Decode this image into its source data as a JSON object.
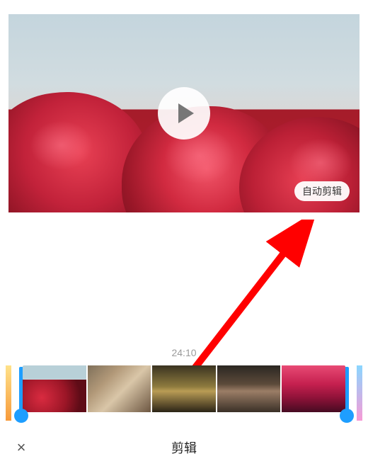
{
  "preview": {
    "play_icon": "play-icon",
    "auto_edit_label": "自动剪辑"
  },
  "timeline": {
    "duration_label": "24:10",
    "thumbnails": [
      {
        "name": "roses"
      },
      {
        "name": "character-1"
      },
      {
        "name": "character-2"
      },
      {
        "name": "character-3"
      },
      {
        "name": "gradient-red"
      }
    ]
  },
  "bottom_bar": {
    "close_icon": "×",
    "title": "剪辑"
  },
  "annotation": {
    "arrow_color": "#ff0000"
  }
}
